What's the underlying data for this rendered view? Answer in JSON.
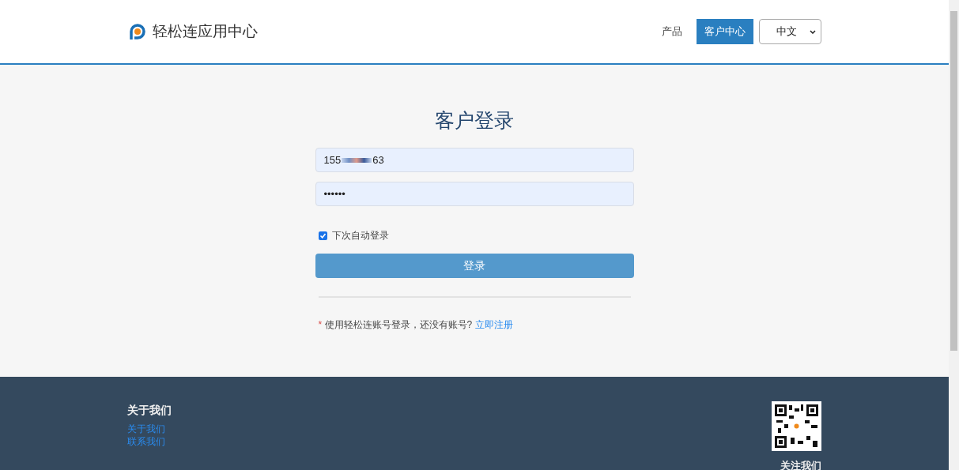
{
  "header": {
    "brand": "轻松连应用中心",
    "nav": [
      {
        "label": "产品",
        "selected": false
      },
      {
        "label": "客户中心",
        "selected": true
      }
    ],
    "language": "中文"
  },
  "login": {
    "title": "客户登录",
    "username": {
      "value_start": "155",
      "value_end": "63"
    },
    "password": {
      "value": "••••••"
    },
    "remember": {
      "label": "下次自动登录",
      "checked": true
    },
    "submit": "登录",
    "note": {
      "prefix": "*",
      "text": "使用轻松连账号登录，还没有账号?",
      "link": "立即注册"
    }
  },
  "footer": {
    "heading": "关于我们",
    "links": [
      "关于我们",
      "联系我们"
    ],
    "follow": "关注我们"
  }
}
